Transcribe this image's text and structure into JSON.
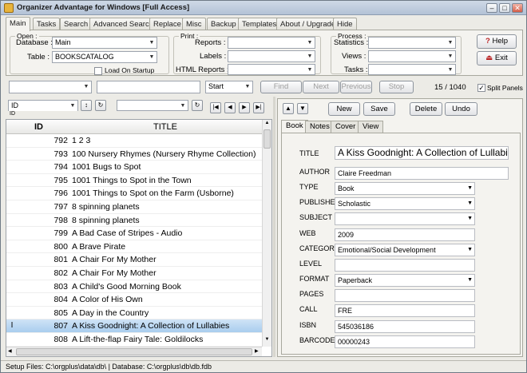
{
  "window": {
    "title": "Organizer Advantage for Windows [Full Access]",
    "minimize": "–",
    "maximize": "□",
    "close": "✕"
  },
  "tabs": [
    "Main",
    "Tasks",
    "Search",
    "Advanced Search",
    "Replace",
    "Misc",
    "Backup",
    "Templates",
    "About / Upgrade",
    "Hide"
  ],
  "open": {
    "group_label": "Open :",
    "database_label": "Database :",
    "database_value": "Main",
    "table_label": "Table :",
    "table_value": "BOOKSCATALOG",
    "load_on_startup": "Load On Startup"
  },
  "print": {
    "group_label": "Print :",
    "reports_label": "Reports :",
    "labels_label": "Labels :",
    "html_reports_label": "HTML Reports :"
  },
  "process": {
    "group_label": "Process :",
    "statistics_label": "Statistics :",
    "views_label": "Views :",
    "tasks_label": "Tasks :"
  },
  "help_button": "Help",
  "exit_button": "Exit",
  "search": {
    "mode_value": "Start",
    "find": "Find",
    "next": "Next",
    "previous": "Previous",
    "stop": "Stop",
    "position": "15 / 1040",
    "split_panels": "Split Panels"
  },
  "sort": {
    "field": "ID",
    "field_small": "ID",
    "sort_icon": "↕",
    "refresh_icon": "↻"
  },
  "nav": {
    "first": "|◀",
    "prev": "◀",
    "next": "▶",
    "last": "▶|",
    "up": "▲",
    "down": "▼"
  },
  "grid": {
    "columns": [
      "ID",
      "TITLE"
    ],
    "rows": [
      {
        "id": "792",
        "title": "1 2 3"
      },
      {
        "id": "793",
        "title": "100 Nursery Rhymes (Nursery Rhyme Collection)"
      },
      {
        "id": "794",
        "title": "1001 Bugs to Spot"
      },
      {
        "id": "795",
        "title": "1001 Things to Spot in the Town"
      },
      {
        "id": "796",
        "title": "1001 Things to Spot on the Farm (Usborne)"
      },
      {
        "id": "797",
        "title": "8 spinning planets"
      },
      {
        "id": "798",
        "title": "8 spinning planets"
      },
      {
        "id": "799",
        "title": "A Bad Case of Stripes - Audio"
      },
      {
        "id": "800",
        "title": "A Brave Pirate"
      },
      {
        "id": "801",
        "title": "A Chair For My Mother"
      },
      {
        "id": "802",
        "title": "A Chair For My Mother"
      },
      {
        "id": "803",
        "title": "A Child's Good Morning Book"
      },
      {
        "id": "804",
        "title": "A Color of His Own"
      },
      {
        "id": "805",
        "title": "A Day in the Country"
      },
      {
        "id": "807",
        "title": "A Kiss Goodnight: A Collection of Lullabies"
      },
      {
        "id": "808",
        "title": "A Lift-the-flap Fairy Tale: Goldilocks"
      }
    ],
    "selected_index": 14,
    "row_indicator": "I"
  },
  "record_buttons": {
    "new": "New",
    "save": "Save",
    "delete": "Delete",
    "undo": "Undo"
  },
  "record_tabs": [
    "Book",
    "Notes",
    "Cover",
    "View"
  ],
  "record": {
    "title_label": "TITLE",
    "title": "A Kiss Goodnight: A Collection of Lullabies",
    "author_label": "AUTHOR",
    "author": "Claire Freedman",
    "type_label": "TYPE",
    "type": "Book",
    "published_label": "PUBLISHED",
    "published": "Scholastic",
    "subject_label": "SUBJECT",
    "subject": "",
    "web_label": "WEB",
    "web": "2009",
    "category_label": "CATEGORY",
    "category": "Emotional/Social Development",
    "level_label": "LEVEL",
    "level": "",
    "format_label": "FORMAT",
    "format": "Paperback",
    "pages_label": "PAGES",
    "pages": "",
    "call_label": "CALL",
    "call": "FRE",
    "isbn_label": "ISBN",
    "isbn": "545036186",
    "barcode_label": "BARCODE",
    "barcode": "00000243"
  },
  "status_bar": "Setup Files: C:\\orgplus\\data\\db\\ | Database: C:\\orgplus\\db\\db.fdb",
  "colors": {
    "selection": "#a9cdee",
    "titlebar": "#b3c2d6"
  }
}
